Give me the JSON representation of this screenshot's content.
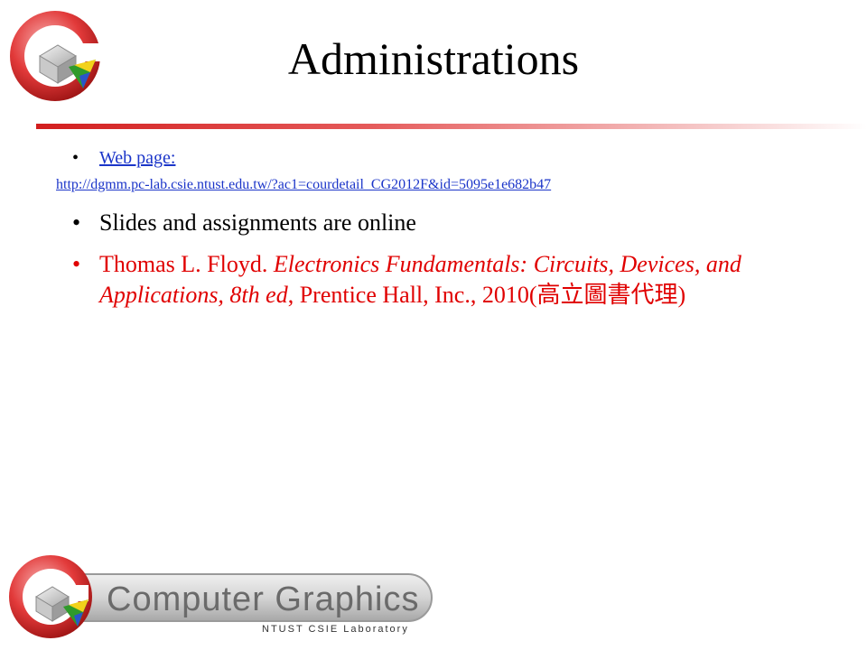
{
  "slide": {
    "title": "Administrations"
  },
  "bullets": {
    "web_label": "Web page:",
    "web_url": "http://dgmm.pc-lab.csie.ntust.edu.tw/?ac1=courdetail_CG2012F&id=5095e1e682b47",
    "slides_text": "Slides and assignments  are online",
    "book_author": "Thomas  L. Floyd. ",
    "book_title": "Electronics Fundamentals: Circuits, Devices, and Applications, 8th ed",
    "book_pub": ", Prentice Hall, Inc., 2010(",
    "book_dist": "高立圖書代理",
    "book_close": ")"
  },
  "footer": {
    "logo_text": "Computer Graphics",
    "logo_subtext": "NTUST CSIE Laboratory"
  },
  "colors": {
    "accent_red": "#d21e1e",
    "link_blue": "#1b35c9",
    "bullet_red": "#e00000"
  }
}
